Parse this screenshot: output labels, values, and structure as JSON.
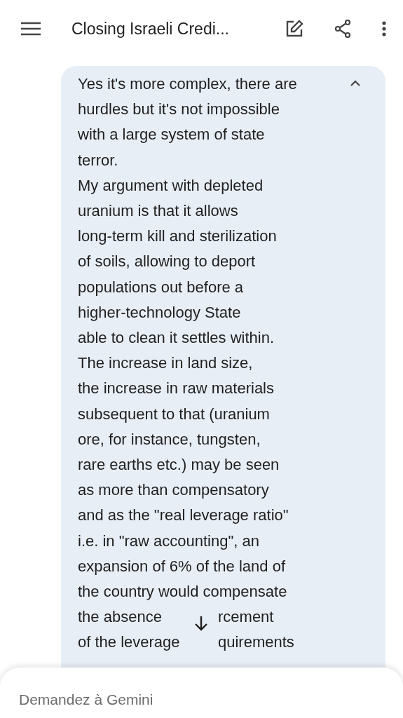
{
  "header": {
    "title": "Closing Israeli Credi..."
  },
  "message": {
    "expanded": true,
    "lines": [
      [
        "Yes it's more complex, there are"
      ],
      [
        "hurdles but it's not impossible"
      ],
      [
        "with a large system of state"
      ],
      [
        "terror."
      ],
      [
        "My argument with depleted"
      ],
      [
        "uranium is that it allows"
      ],
      [
        "long-term kill and sterilization"
      ],
      [
        "of soils, allowing to deport"
      ],
      [
        "populations out before a"
      ],
      [
        "higher-technology State"
      ],
      [
        "able to clean it settles within."
      ],
      [
        "The increase in land size,"
      ],
      [
        "the increase in raw materials"
      ],
      [
        "subsequent to that (uranium"
      ],
      [
        "ore, for instance, tungsten,"
      ],
      [
        "rare earths etc.) may be seen"
      ],
      [
        "as more than compensatory"
      ],
      [
        "and as the \"real leverage ratio\""
      ],
      [
        "i.e. in \"raw accounting\", an"
      ],
      [
        "expansion of 6% of the land of"
      ],
      [
        "the country would compensate"
      ],
      [
        "the absence",
        "rcement"
      ],
      [
        "of the leverage",
        "quirements"
      ]
    ]
  },
  "input": {
    "placeholder": "Demandez à Gemini"
  }
}
